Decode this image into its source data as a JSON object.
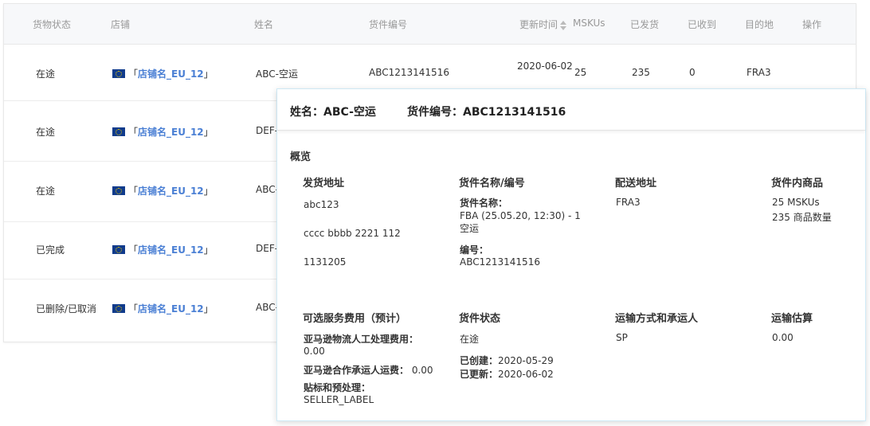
{
  "table": {
    "headers": {
      "status": "货物状态",
      "store": "店铺",
      "name": "姓名",
      "shipment_id": "货件编号",
      "updated": "更新时间",
      "mskus": "MSKUs",
      "shipped": "已发货",
      "received": "已收到",
      "destination": "目的地",
      "actions": "操作"
    },
    "rows": [
      {
        "status": "在途",
        "store": "店铺名_EU_12",
        "name": "ABC-空运",
        "shipment_id": "ABC1213141516",
        "updated": "2020-06-02",
        "mskus": "25",
        "shipped": "235",
        "received": "0",
        "destination": "FRA3"
      },
      {
        "status": "在途",
        "store": "店铺名_EU_12",
        "name": "DEF-"
      },
      {
        "status": "在途",
        "store": "店铺名_EU_12",
        "name": "ABC-"
      },
      {
        "status": "已完成",
        "store": "店铺名_EU_12",
        "name": "DEF-"
      },
      {
        "status": "已删除/已取消",
        "store": "店铺名_EU_12",
        "name": "ABC-"
      }
    ],
    "bracket_open": "「",
    "bracket_close": "」"
  },
  "popup": {
    "name_label": "姓名：ABC-空运",
    "shipment_label": "货件编号：ABC1213141516",
    "overview": "概览",
    "ship_from": {
      "title": "发货地址",
      "line1": "abc123",
      "line2": "cccc bbbb 2221 112",
      "line3": "1131205"
    },
    "shipment_name": {
      "title": "货件名称/编号",
      "name_label": "货件名称：",
      "name_value": "FBA (25.05.20, 12:30) - 1 空运",
      "id_label": "编号：",
      "id_value": "ABC1213141516"
    },
    "ship_to": {
      "title": "配送地址",
      "value": "FRA3"
    },
    "contents": {
      "title": "货件内商品",
      "mskus": "25 MSKUs",
      "qty": "235 商品数量"
    },
    "services": {
      "title": "可选服务费用（预计）",
      "labor_label": "亚马逊物流人工处理费用：",
      "labor_value": "0.00",
      "carrier_label": "亚马逊合作承运人运费：",
      "carrier_value": "0.00",
      "label_label": "贴标和预处理：",
      "label_value": "SELLER_LABEL"
    },
    "status": {
      "title": "货件状态",
      "value": "在途",
      "created_label": "已创建：",
      "created_value": "2020-05-29",
      "updated_label": "已更新：",
      "updated_value": "2020-06-02"
    },
    "shipping_method": {
      "title": "运输方式和承运人",
      "value": "SP"
    },
    "estimate": {
      "title": "运输估算",
      "value": "0.00"
    }
  },
  "colors": {
    "store_link": "#4a7fd4",
    "flag_blue": "#103b8c",
    "popup_border": "#cfeaf6"
  }
}
